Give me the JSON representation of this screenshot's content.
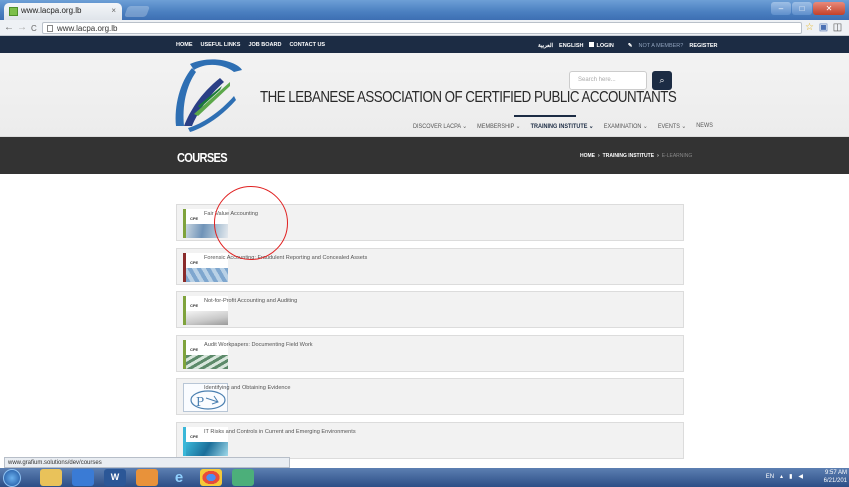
{
  "browser": {
    "tab_title": "www.lacpa.org.lb",
    "tab_close": "×",
    "address": "www.lacpa.org.lb",
    "nav_back": "←",
    "nav_forward": "→",
    "nav_reload": "C",
    "win_min": "–",
    "win_max": "□",
    "win_close": "✕",
    "toolbar_icons": [
      "☆",
      "▣",
      "◫"
    ]
  },
  "topbar": {
    "left_links": [
      "HOME",
      "USEFUL LINKS",
      "JOB BOARD",
      "CONTACT US"
    ],
    "arabic": "العربية",
    "english": "ENGLISH",
    "login": "LOGIN",
    "not_member": "NOT A MEMBER?",
    "register": "REGISTER"
  },
  "header": {
    "site_title": "THE LEBANESE ASSOCIATION OF CERTIFIED PUBLIC ACCOUNTANTS",
    "logo_ring_text": "Lebanese Association of Certified Public Accountants",
    "search_placeholder": "Search here...",
    "search_icon": "search-icon",
    "menu": [
      {
        "label": "DISCOVER LACPA",
        "caret": "⌄"
      },
      {
        "label": "MEMBERSHIP",
        "caret": "⌄"
      },
      {
        "label": "TRAINING INSTITUTE",
        "caret": "⌄"
      },
      {
        "label": "EXAMINATION",
        "caret": "⌄"
      },
      {
        "label": "EVENTS",
        "caret": "⌄"
      },
      {
        "label": "NEWS",
        "caret": ""
      }
    ]
  },
  "banner": {
    "title": "COURSES",
    "breadcrumb": [
      "HOME",
      "TRAINING INSTITUTE",
      "E-LEARNING"
    ],
    "sep": "›"
  },
  "courses": [
    {
      "name": "Fair Value Accounting",
      "badge": "CPE",
      "bar": "#7fa33c"
    },
    {
      "name": "Forensic Accounting: Fraudulent Reporting and Concealed Assets",
      "badge": "CPE",
      "bar": "#8a2b2b"
    },
    {
      "name": "Not-for-Profit Accounting and Auditing",
      "badge": "CPE",
      "bar": "#7fa33c"
    },
    {
      "name": "Audit Workpapers: Documenting Field Work",
      "badge": "CPE",
      "bar": "#7fa33c"
    },
    {
      "name": "Identifying and Obtaining Evidence",
      "badge": "",
      "bar": ""
    },
    {
      "name": "IT Risks and Controls in Current and Emerging Environments",
      "badge": "CPE",
      "bar": "#3ab7d8"
    }
  ],
  "status_url": "www.grafium.solutions/dev/courses",
  "taskbar": {
    "apps": [
      "",
      "W",
      "",
      "e",
      "",
      ""
    ],
    "lang": "EN",
    "time": "9:57 AM",
    "date": "6/21/201"
  }
}
